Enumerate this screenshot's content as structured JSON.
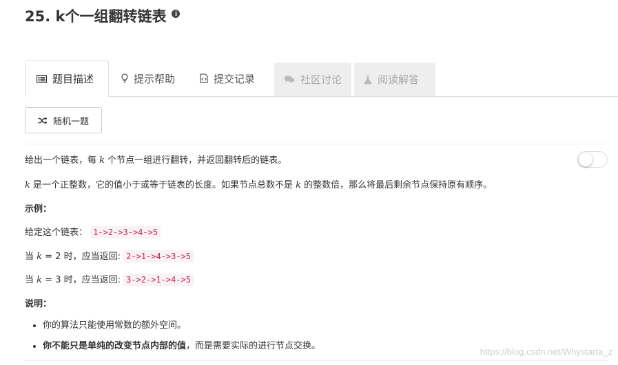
{
  "problem": {
    "title": "25. k个一组翻转链表",
    "info_icon": "i"
  },
  "tabs": [
    {
      "label": "题目描述",
      "icon": "list-icon",
      "state": "active"
    },
    {
      "label": "提示帮助",
      "icon": "lightbulb-icon",
      "state": "normal"
    },
    {
      "label": "提交记录",
      "icon": "code-file-icon",
      "state": "normal"
    },
    {
      "label": "社区讨论",
      "icon": "comments-icon",
      "state": "disabled"
    },
    {
      "label": "阅读解答",
      "icon": "flask-icon",
      "state": "disabled"
    }
  ],
  "random_button": {
    "label": "随机一题",
    "icon": "shuffle-icon"
  },
  "description": {
    "line1_a": "给出一个链表，每 ",
    "line1_k": "k",
    "line1_b": " 个节点一组进行翻转，并返回翻转后的链表。",
    "line2_k1": "k",
    "line2_a": " 是一个正整数，它的值小于或等于链表的长度。如果节点总数不是 ",
    "line2_k2": "k",
    "line2_b": " 的整数倍，那么将最后剩余节点保持原有顺序。",
    "example_heading": "示例：",
    "given_label": "给定这个链表：",
    "given_code": "1->2->3->4->5",
    "case1_prefix": "当 ",
    "case1_k": "k",
    "case1_mid": " = 2 时，应当返回: ",
    "case1_code": "2->1->4->3->5",
    "case2_prefix": "当 ",
    "case2_k": "k",
    "case2_mid": " = 3 时，应当返回: ",
    "case2_code": "3->2->1->4->5",
    "note_heading": "说明：",
    "notes": [
      "你的算法只能使用常数的额外空间。",
      "你不能只是单纯的改变节点内部的值，而是需要实际的进行节点交换。"
    ],
    "note2_bold": "你不能只是单纯的改变节点内部的值",
    "note2_rest": "，而是需要实际的进行节点交换。"
  },
  "toggle": {
    "state": "off"
  },
  "watermark": "https://blog.csdn.net/Whystarta_z",
  "colors": {
    "code_text": "#c7254e",
    "code_bg": "#f9f2f4",
    "disabled_tab_bg": "#eeeeee",
    "border": "#dddddd"
  }
}
